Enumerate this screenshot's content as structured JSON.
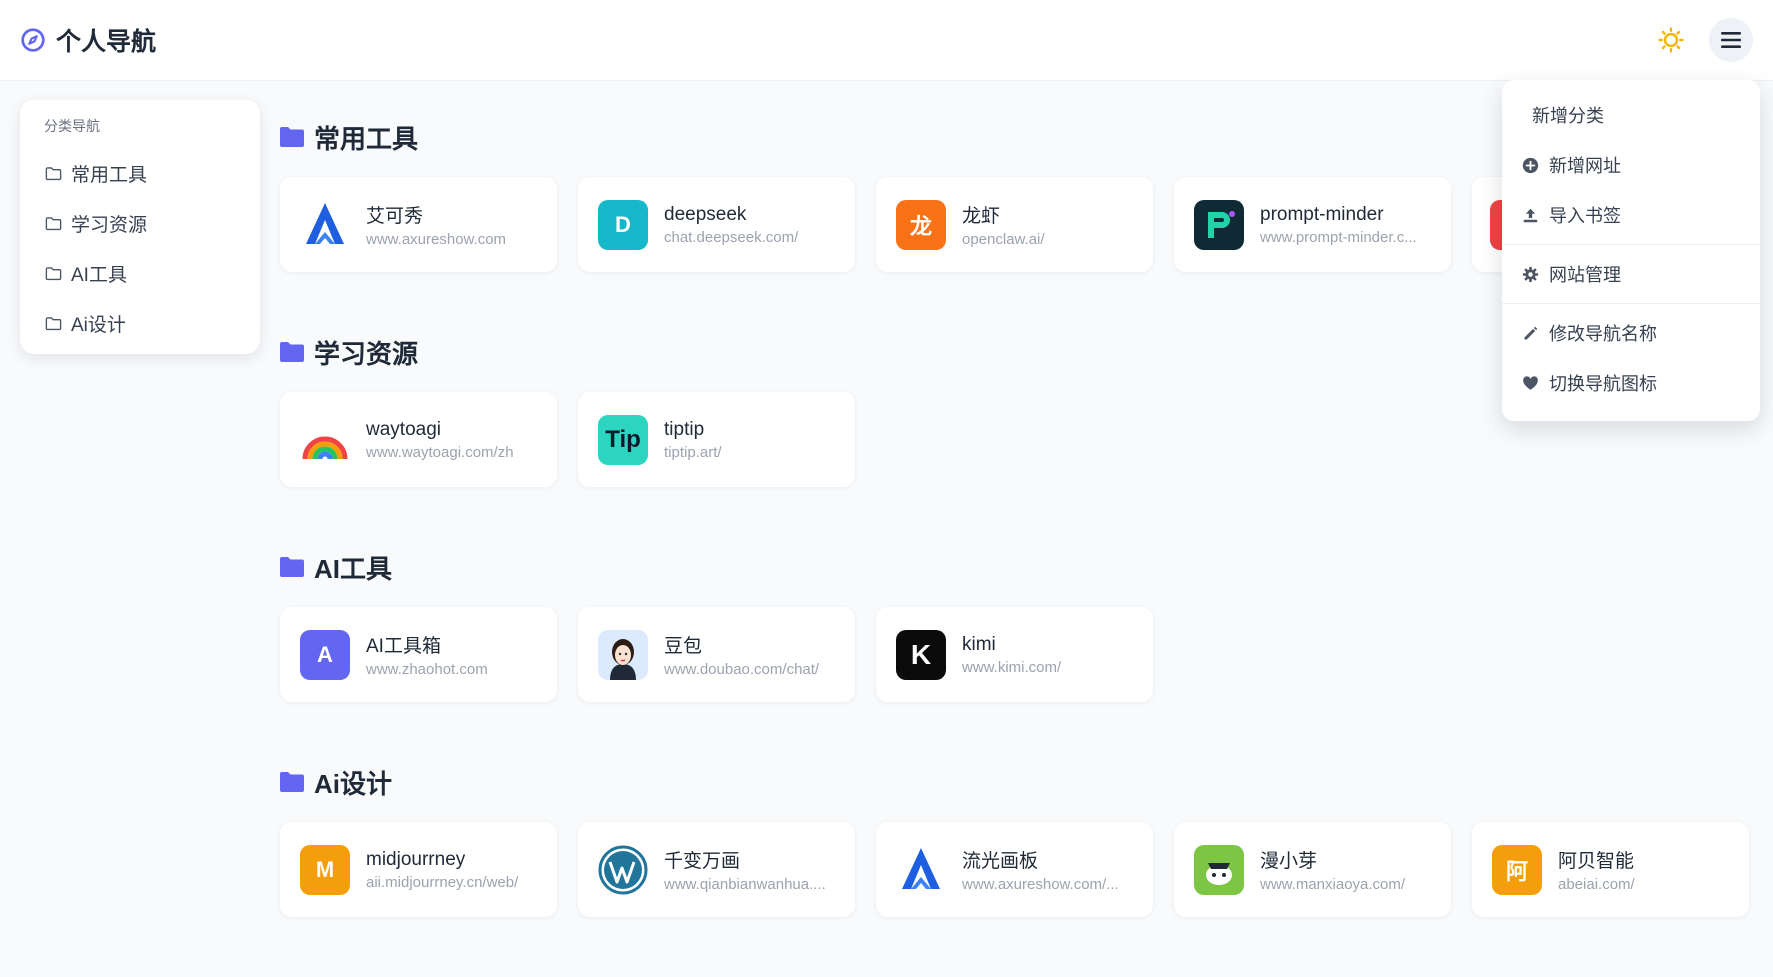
{
  "header": {
    "title": "个人导航",
    "logo_icon": "compass-icon",
    "theme_icon": "sun-icon",
    "menu_icon": "hamburger-icon"
  },
  "sidebar": {
    "title": "分类导航",
    "items": [
      {
        "label": "常用工具"
      },
      {
        "label": "学习资源"
      },
      {
        "label": "AI工具"
      },
      {
        "label": "Ai设计"
      }
    ]
  },
  "sections": [
    {
      "title": "常用工具",
      "cards": [
        {
          "name": "艾可秀",
          "url": "www.axureshow.com",
          "icon": "axure-logo"
        },
        {
          "name": "deepseek",
          "url": "chat.deepseek.com/",
          "icon": "D"
        },
        {
          "name": "龙虾",
          "url": "openclaw.ai/",
          "icon": "龙"
        },
        {
          "name": "prompt-minder",
          "url": "www.prompt-minder.c...",
          "icon": "prompt-minder-logo"
        },
        {
          "name": "",
          "url": "",
          "icon": "partial-red-tile"
        }
      ]
    },
    {
      "title": "学习资源",
      "cards": [
        {
          "name": "waytoagi",
          "url": "www.waytoagi.com/zh",
          "icon": "rainbow-logo"
        },
        {
          "name": "tiptip",
          "url": "tiptip.art/",
          "icon": "Tip"
        }
      ]
    },
    {
      "title": "AI工具",
      "cards": [
        {
          "name": "AI工具箱",
          "url": "www.zhaohot.com",
          "icon": "A"
        },
        {
          "name": "豆包",
          "url": "www.doubao.com/chat/",
          "icon": "doubao-avatar"
        },
        {
          "name": "kimi",
          "url": "www.kimi.com/",
          "icon": "K"
        }
      ]
    },
    {
      "title": "Ai设计",
      "cards": [
        {
          "name": "midjourrney",
          "url": "aii.midjourrney.cn/web/",
          "icon": "M"
        },
        {
          "name": "千变万画",
          "url": "www.qianbianwanhua....",
          "icon": "wordpress-logo"
        },
        {
          "name": "流光画板",
          "url": "www.axureshow.com/...",
          "icon": "axure-logo"
        },
        {
          "name": "漫小芽",
          "url": "www.manxiaoya.com/",
          "icon": "manxiaoya-logo"
        },
        {
          "name": "阿贝智能",
          "url": "abeiai.com/",
          "icon": "阿"
        }
      ]
    }
  ],
  "dropdown": {
    "items": [
      {
        "label": "新增分类",
        "icon": ""
      },
      {
        "label": "新增网址",
        "icon": "plus-circle-icon"
      },
      {
        "label": "导入书签",
        "icon": "upload-icon"
      },
      {
        "label": "网站管理",
        "icon": "gear-icon"
      },
      {
        "label": "修改导航名称",
        "icon": "pencil-icon"
      },
      {
        "label": "切换导航图标",
        "icon": "heart-icon"
      }
    ]
  },
  "colors": {
    "accent": "#6366f1",
    "sun": "#f5b400",
    "deepseek": "#14b8c8",
    "longxia": "#f97316",
    "tiptip": "#2dd4bf",
    "ai_box": "#6366f1",
    "midjourrney": "#f59e0b",
    "abei": "#f59e0b",
    "manxiaoya": "#7cc644"
  }
}
